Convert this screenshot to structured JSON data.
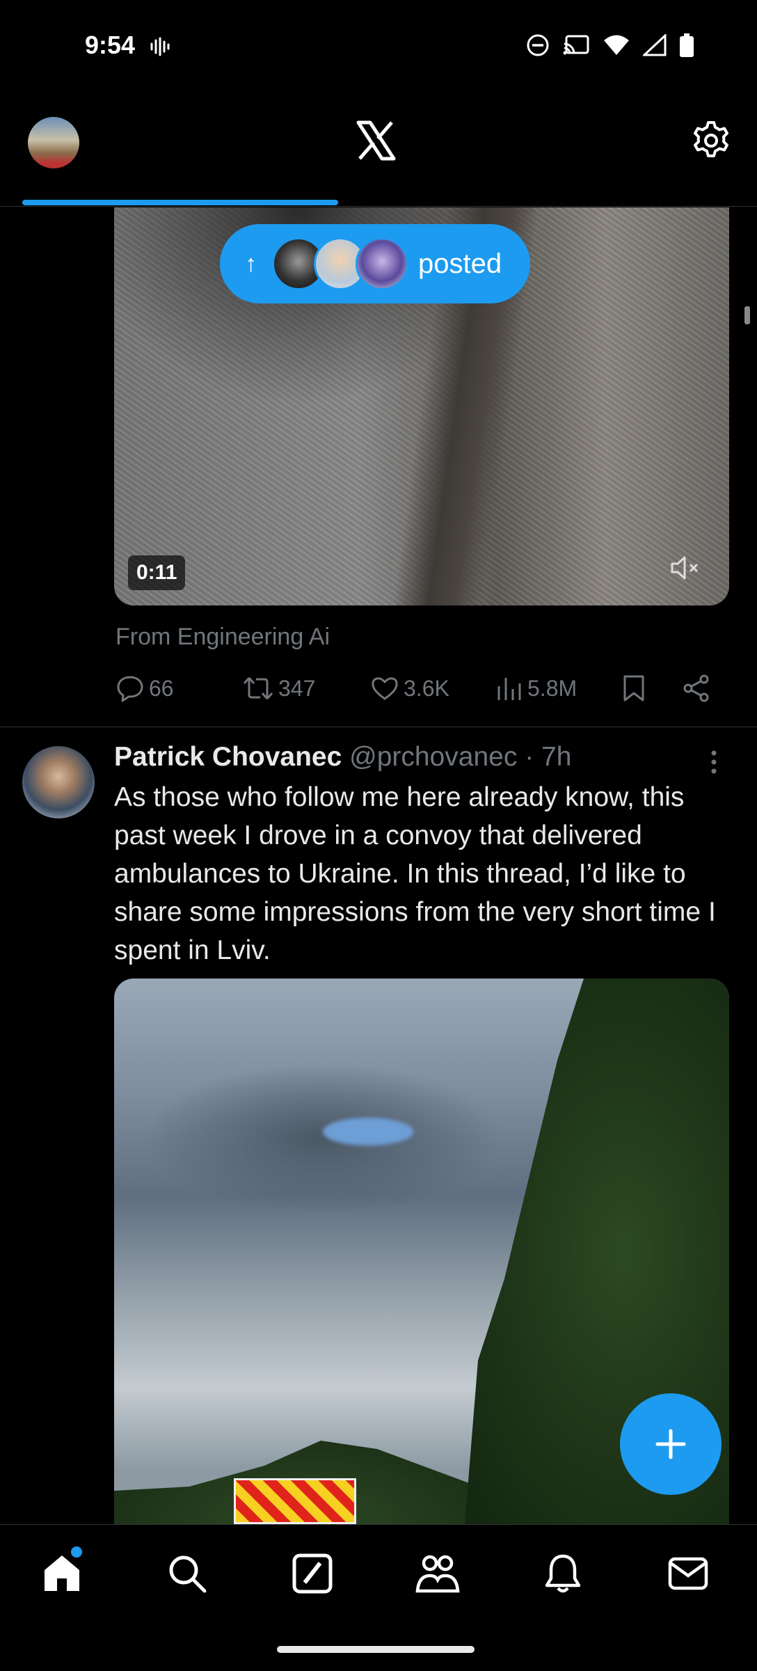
{
  "status_bar": {
    "time": "9:54",
    "icons": [
      "voice-activity-icon",
      "dnd-icon",
      "cast-icon",
      "wifi-icon",
      "signal-icon",
      "battery-icon"
    ]
  },
  "top_bar": {
    "logo": "X",
    "icons": [
      "profile-avatar",
      "x-logo-icon",
      "settings-gear-icon"
    ]
  },
  "colors": {
    "accent": "#1d9bf0",
    "background": "#000000",
    "muted": "#71767b",
    "text": "#e7e9ea"
  },
  "new_posts_pill": {
    "label": "posted",
    "arrow": "↑"
  },
  "post1": {
    "video_duration": "0:11",
    "source": "From Engineering Ai",
    "replies": "66",
    "reposts": "347",
    "likes": "3.6K",
    "views": "5.8M"
  },
  "post2": {
    "author_name": "Patrick Chovanec",
    "author_meta": " @prchovanec · 7h",
    "text": "As those who follow me here already know, this past week I drove in a convoy that delivered ambulances to Ukraine. In this thread, I’d like to share some impressions from the very short time I spent in Lviv."
  },
  "bottom_nav": {
    "items": [
      "home-icon",
      "search-icon",
      "grok-icon",
      "communities-icon",
      "notifications-icon",
      "messages-icon"
    ]
  }
}
